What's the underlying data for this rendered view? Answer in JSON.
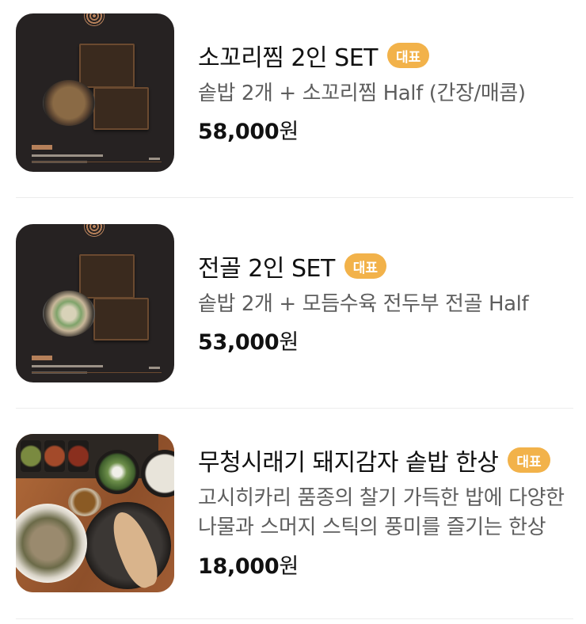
{
  "menu": {
    "items": [
      {
        "title": "소꼬리찜 2인 SET",
        "badge": "대표",
        "description": "솥밥 2개 + 소꼬리찜 Half (간장/매콤)",
        "price_number": "58,000",
        "price_unit": "원",
        "image": "oxtail-set-photo"
      },
      {
        "title": "전골 2인 SET",
        "badge": "대표",
        "description": "솥밥 2개 + 모듬수육 전두부 전골 Half",
        "price_number": "53,000",
        "price_unit": "원",
        "image": "jeongol-set-photo"
      },
      {
        "title": "무청시래기 돼지감자 솥밥 한상",
        "badge": "대표",
        "description": "고시히카리 품종의 찰기 가득한 밥에 다양한 나물과 스머지 스틱의 풍미를 즐기는 한상",
        "price_number": "18,000",
        "price_unit": "원",
        "image": "hansang-photo"
      }
    ]
  },
  "colors": {
    "badge_bg": "#f2b24a",
    "badge_text": "#ffffff",
    "title_text": "#111111",
    "desc_text": "#5e5e5e",
    "divider": "#ececec"
  }
}
